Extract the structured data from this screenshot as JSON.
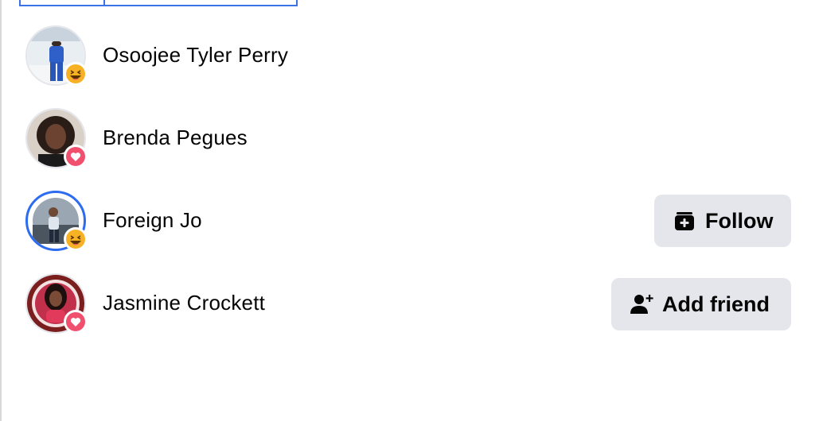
{
  "people": [
    {
      "name": "Osoojee Tyler Perry",
      "reaction": "haha-emoji-icon",
      "story_ring": false,
      "button": null
    },
    {
      "name": "Brenda Pegues",
      "reaction": "heart-reaction-icon",
      "story_ring": false,
      "button": null
    },
    {
      "name": "Foreign Jo",
      "reaction": "haha-emoji-icon",
      "story_ring": true,
      "button": {
        "label": "Follow",
        "icon": "follow-page-icon"
      }
    },
    {
      "name": "Jasmine Crockett",
      "reaction": "heart-reaction-icon",
      "story_ring": false,
      "button": {
        "label": "Add friend",
        "icon": "add-friend-icon"
      }
    }
  ],
  "colors": {
    "accent": "#3b73e6",
    "button_bg": "#e4e6eb",
    "heart": "#f0506e",
    "haha": "#f7b125"
  }
}
